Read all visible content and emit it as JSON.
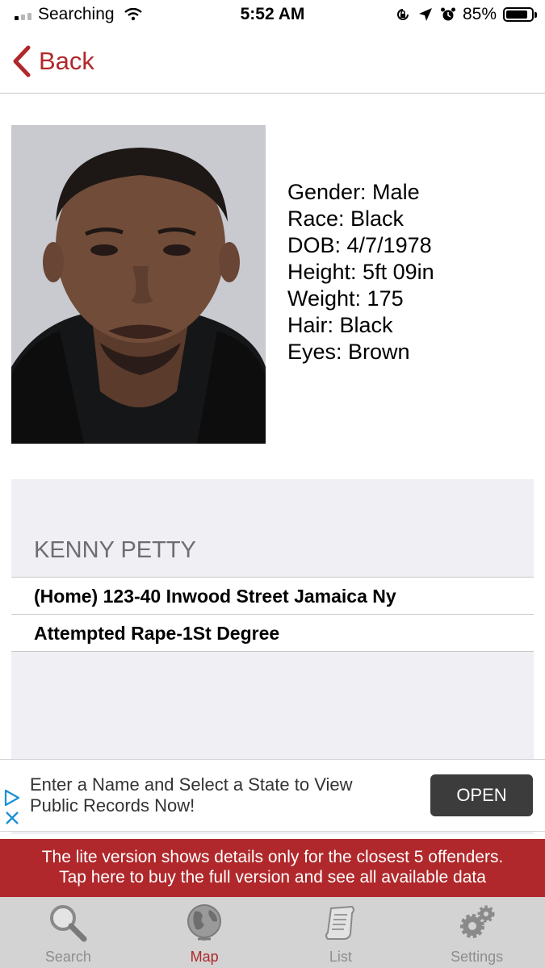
{
  "status_bar": {
    "carrier": "Searching",
    "time": "5:52 AM",
    "battery_percent": "85%",
    "battery_level": 0.85
  },
  "nav": {
    "back_label": "Back"
  },
  "profile": {
    "gender": "Gender: Male",
    "race": "Race: Black",
    "dob": "DOB: 4/7/1978",
    "height": "Height: 5ft 09in",
    "weight": "Weight: 175",
    "hair": "Hair: Black",
    "eyes": "Eyes: Brown"
  },
  "record": {
    "name": "KENNY PETTY",
    "address": "(Home) 123-40 Inwood Street Jamaica Ny",
    "offense": "Attempted Rape-1St Degree"
  },
  "ad": {
    "line1": "Enter a Name and Select a State to View",
    "line2": "Public Records Now!",
    "button": "OPEN"
  },
  "banner": {
    "line1": "The lite version shows details only for the closest 5 offenders.",
    "line2": "Tap here to buy the full version and see all available data"
  },
  "tabs": [
    {
      "label": "Search",
      "icon": "magnifier-icon"
    },
    {
      "label": "Map",
      "icon": "globe-icon"
    },
    {
      "label": "List",
      "icon": "scroll-icon"
    },
    {
      "label": "Settings",
      "icon": "gears-icon"
    }
  ],
  "colors": {
    "accent": "#b0282b",
    "tabbar": "#d3d3d3",
    "card": "#efeff4"
  }
}
